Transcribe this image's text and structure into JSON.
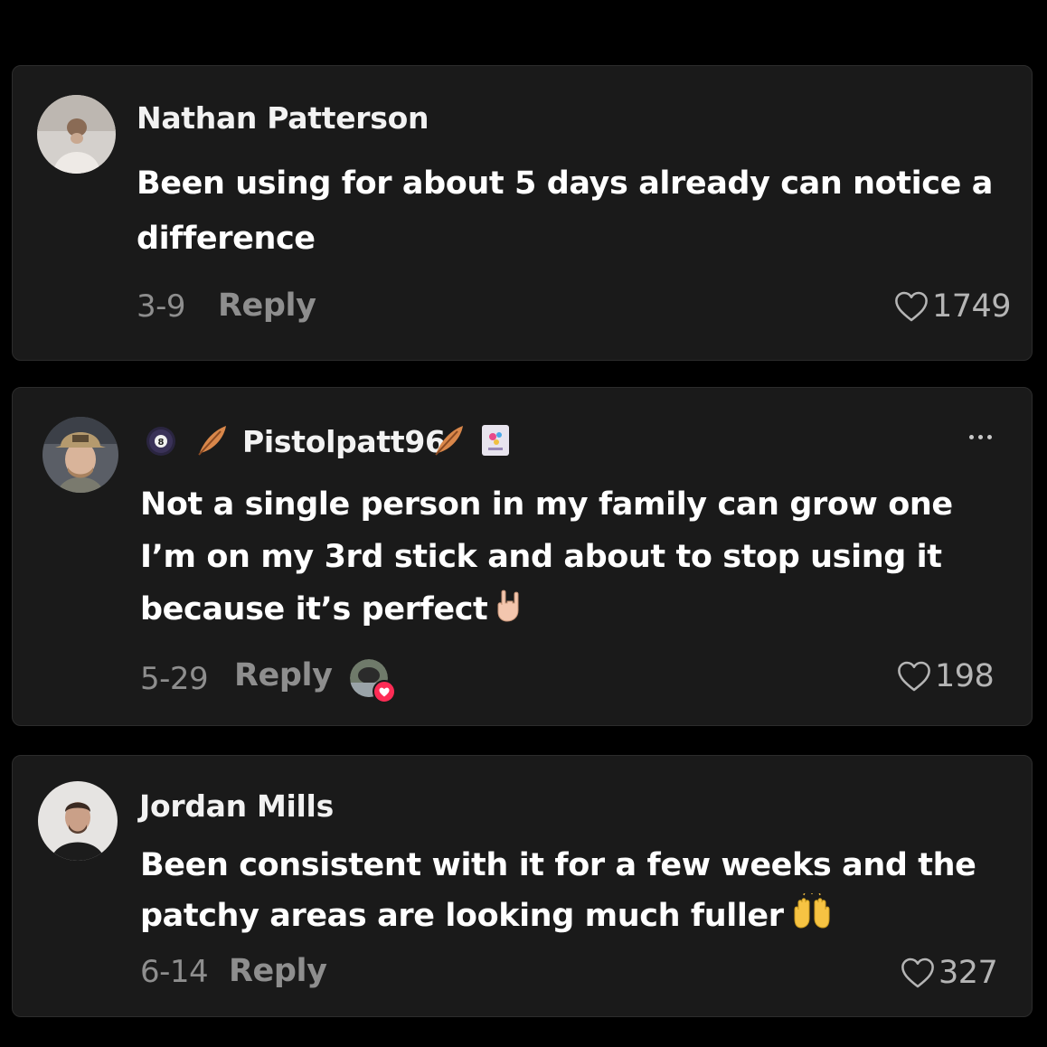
{
  "comments": [
    {
      "username": "Nathan Patterson",
      "text": "Been using for about 5 days already can notice a difference",
      "date": "3-9",
      "reply_label": "Reply",
      "likes": "1749"
    },
    {
      "username": "Pistolpatt96",
      "text": "Not a single person in my family can grow one I’m on my 3rd stick and about to stop using it because it’s perfect",
      "emoji": "rock-on-hand",
      "date": "5-29",
      "reply_label": "Reply",
      "likes": "198",
      "liked_by_creator": true
    },
    {
      "username": "Jordan Mills",
      "text": "Been consistent with it for a few weeks and the patchy areas are looking much fuller",
      "emoji": "raising-hands",
      "date": "6-14",
      "reply_label": "Reply",
      "likes": "327"
    }
  ],
  "colors": {
    "background": "#000000",
    "card": "#1a1a1a",
    "muted_text": "#8e8e8e",
    "like_badge": "#fe2c55"
  }
}
